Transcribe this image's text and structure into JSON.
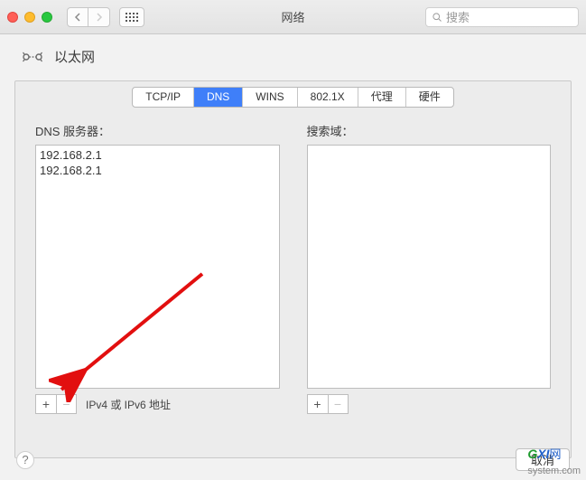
{
  "window": {
    "title": "网络",
    "search_placeholder": "搜索"
  },
  "header": {
    "interface_name": "以太网"
  },
  "tabs": [
    {
      "label": "TCP/IP",
      "active": false
    },
    {
      "label": "DNS",
      "active": true
    },
    {
      "label": "WINS",
      "active": false
    },
    {
      "label": "802.1X",
      "active": false
    },
    {
      "label": "代理",
      "active": false
    },
    {
      "label": "硬件",
      "active": false
    }
  ],
  "dns_section": {
    "label": "DNS 服务器：",
    "servers": [
      "192.168.2.1",
      "192.168.2.1"
    ],
    "hint": "IPv4 或 IPv6 地址"
  },
  "search_domains_section": {
    "label": "搜索域："
  },
  "buttons": {
    "cancel": "取消"
  },
  "watermark": {
    "g": "G",
    "xi": "XI",
    "rest": "网",
    "domain": "system.com"
  }
}
